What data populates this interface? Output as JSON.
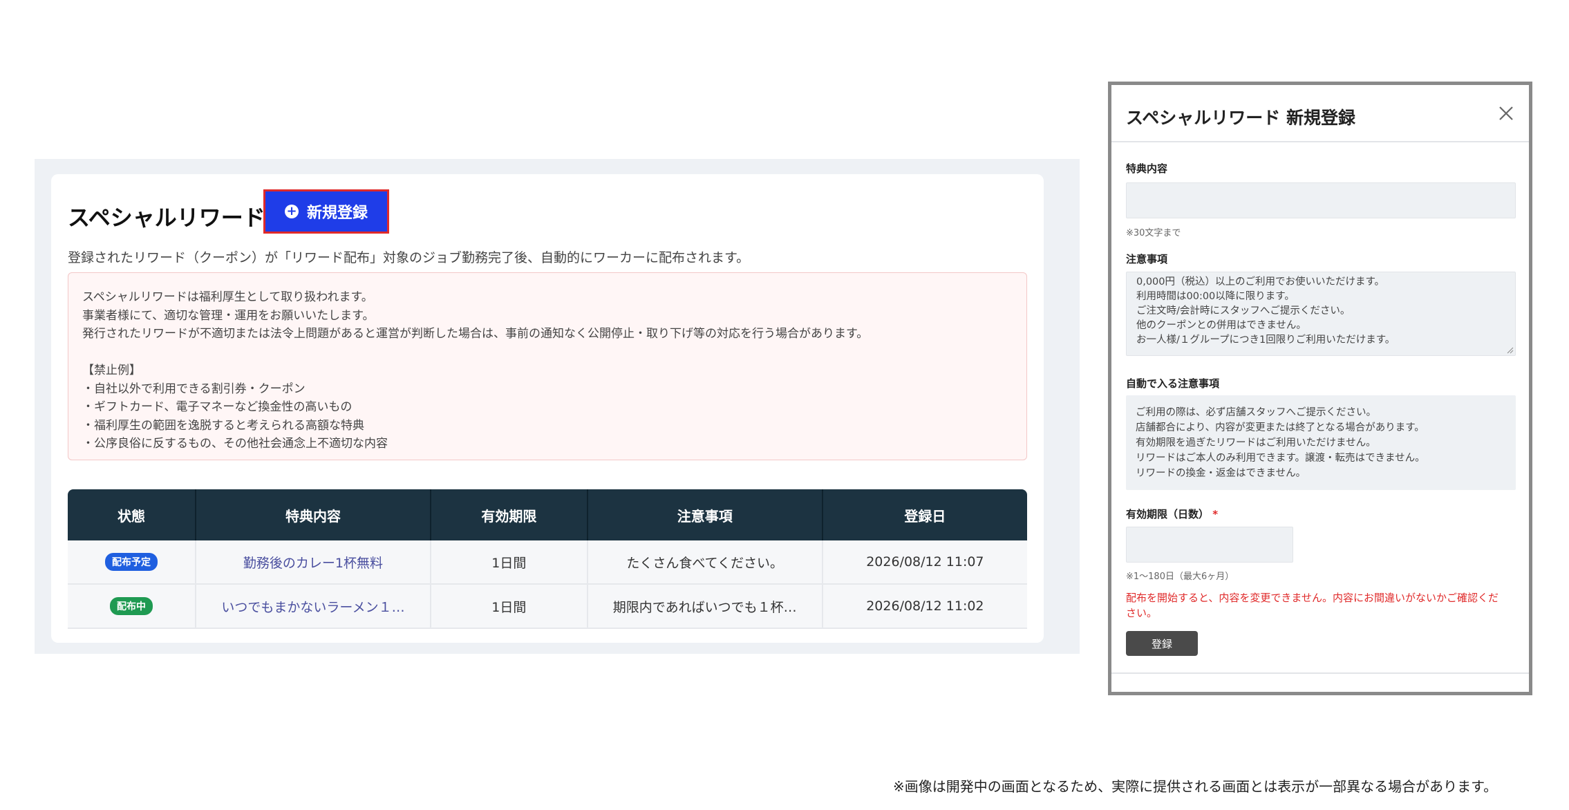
{
  "main": {
    "title": "スペシャルリワード",
    "new_button_label": "新規登録",
    "description": "登録されたリワード（クーポン）が「リワード配布」対象のジョブ勤務完了後、自動的にワーカーに配布されます。",
    "notice_lines": [
      "スペシャルリワードは福利厚生として取り扱われます。",
      "事業者様にて、適切な管理・運用をお願いいたします。",
      "発行されたリワードが不適切または法令上問題があると運営が判断した場合は、事前の通知なく公開停止・取り下げ等の対応を行う場合があります。",
      "",
      "【禁止例】",
      "・自社以外で利用できる割引券・クーポン",
      "・ギフトカード、電子マネーなど換金性の高いもの",
      "・福利厚生の範囲を逸脱すると考えられる高額な特典",
      "・公序良俗に反するもの、その他社会通念上不適切な内容"
    ],
    "table": {
      "headers": [
        "状態",
        "特典内容",
        "有効期限",
        "注意事項",
        "登録日"
      ],
      "rows": [
        {
          "status": "配布予定",
          "status_color": "#1f5fe0",
          "benefit": "勤務後のカレー1杯無料",
          "validity": "1日間",
          "notes": "たくさん食べてください。",
          "date": "2026/08/12 11:07"
        },
        {
          "status": "配布中",
          "status_color": "#1f9a52",
          "benefit": "いつでもまかないラーメン１…",
          "validity": "1日間",
          "notes": "期限内であればいつでも１杯…",
          "date": "2026/08/12 11:02"
        }
      ]
    }
  },
  "modal": {
    "title": "スペシャルリワード 新規登録",
    "benefit_label": "特典内容",
    "benefit_value": "",
    "benefit_hint": "※30文字まで",
    "notes_label": "注意事項",
    "notes_lines": [
      "0,000円（税込）以上のご利用でお使いいただけます。",
      "利用時間は00:00以降に限ります。",
      "ご注文時/会計時にスタッフへご提示ください。",
      "他のクーポンとの併用はできません。",
      "お一人様/１グループにつき1回限りご利用いただけます。"
    ],
    "auto_label": "自動で入る注意事項",
    "auto_lines": [
      "ご利用の際は、必ず店舗スタッフへご提示ください。",
      "店舗都合により、内容が変更または終了となる場合があります。",
      "有効期限を過ぎたリワードはご利用いただけません。",
      "リワードはご本人のみ利用できます。譲渡・転売はできません。",
      "リワードの換金・返金はできません。"
    ],
    "validity_label": "有効期限（日数）",
    "required_mark": "*",
    "validity_value": "",
    "validity_hint": "※1〜180日（最大6ヶ月）",
    "warning": "配布を開始すると、内容を変更できません。内容にお間違いがないかご確認ください。",
    "submit_label": "登録"
  },
  "footnote": "※画像は開発中の画面となるため、実際に提供される画面とは表示が一部異なる場合があります。",
  "colors": {
    "primary_button": "#1f3de8",
    "header": "#1c3341",
    "warning": "#e02a2a"
  },
  "icons": [
    "plus-circle-icon",
    "close-icon",
    "resize-handle-icon"
  ]
}
